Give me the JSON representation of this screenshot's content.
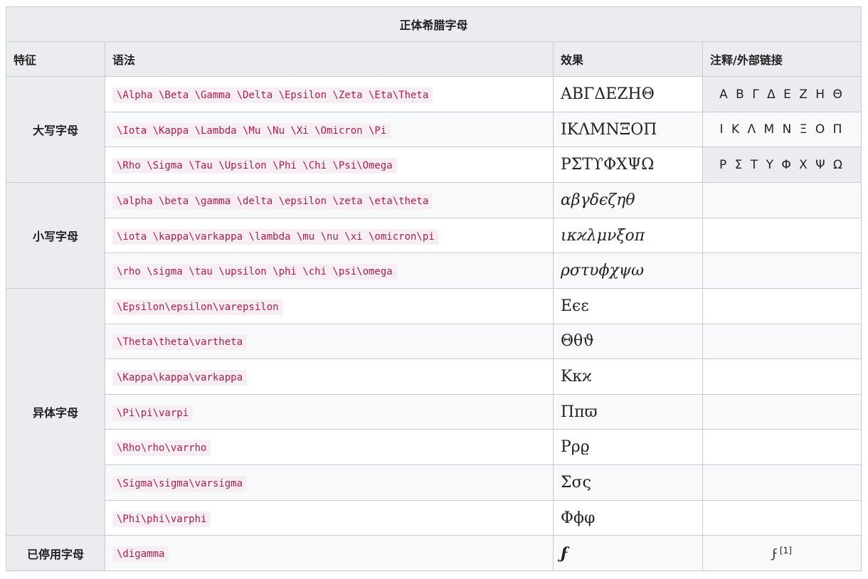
{
  "caption": "正体希腊字母",
  "headers": {
    "feature": "特征",
    "syntax": "语法",
    "effect": "效果",
    "notes": "注释/外部链接"
  },
  "groups": {
    "uppercase": "大写字母",
    "lowercase": "小写字母",
    "variants": "异体字母",
    "obsolete": "已停用字母"
  },
  "rows": [
    {
      "syntax": "\\Alpha \\Beta \\Gamma \\Delta \\Epsilon \\Zeta \\Eta\\Theta",
      "effect": "ΑΒΓΔΕΖΗΘ",
      "note": "Α Β Γ Δ Ε Ζ Η Θ"
    },
    {
      "syntax": "\\Iota \\Kappa \\Lambda \\Mu \\Nu \\Xi \\Omicron \\Pi",
      "effect": "ΙΚΛΜΝΞΟΠ",
      "note": "Ι Κ Λ Μ Ν Ξ Ο Π"
    },
    {
      "syntax": "\\Rho \\Sigma \\Tau \\Upsilon \\Phi \\Chi \\Psi\\Omega",
      "effect": "ΡΣΤϒΦΧΨΩ",
      "note": "Ρ Σ Τ Υ Φ Χ Ψ Ω"
    },
    {
      "syntax": "\\alpha \\beta \\gamma \\delta \\epsilon \\zeta \\eta\\theta",
      "effect": "αβγδϵζηθ",
      "note": ""
    },
    {
      "syntax": "\\iota \\kappa\\varkappa \\lambda \\mu \\nu \\xi \\omicron\\pi",
      "effect": "ικϰλμνξοπ",
      "note": ""
    },
    {
      "syntax": "\\rho \\sigma \\tau \\upsilon \\phi \\chi \\psi\\omega",
      "effect": "ρστυϕχψω",
      "note": ""
    },
    {
      "syntax": "\\Epsilon\\epsilon\\varepsilon",
      "effect": "Εϵε",
      "note": ""
    },
    {
      "syntax": "\\Theta\\theta\\vartheta",
      "effect": "Θθϑ",
      "note": ""
    },
    {
      "syntax": "\\Kappa\\kappa\\varkappa",
      "effect": "Κκϰ",
      "note": ""
    },
    {
      "syntax": "\\Pi\\pi\\varpi",
      "effect": "Ππϖ",
      "note": ""
    },
    {
      "syntax": "\\Rho\\rho\\varrho",
      "effect": "Ρρϱ",
      "note": ""
    },
    {
      "syntax": "\\Sigma\\sigma\\varsigma",
      "effect": "Σσς",
      "note": ""
    },
    {
      "syntax": "\\Phi\\phi\\varphi",
      "effect": "Φϕφ",
      "note": ""
    },
    {
      "syntax": "\\digamma",
      "effect": "ϝ",
      "note": "ϝ",
      "note_ref": "[1]"
    }
  ]
}
